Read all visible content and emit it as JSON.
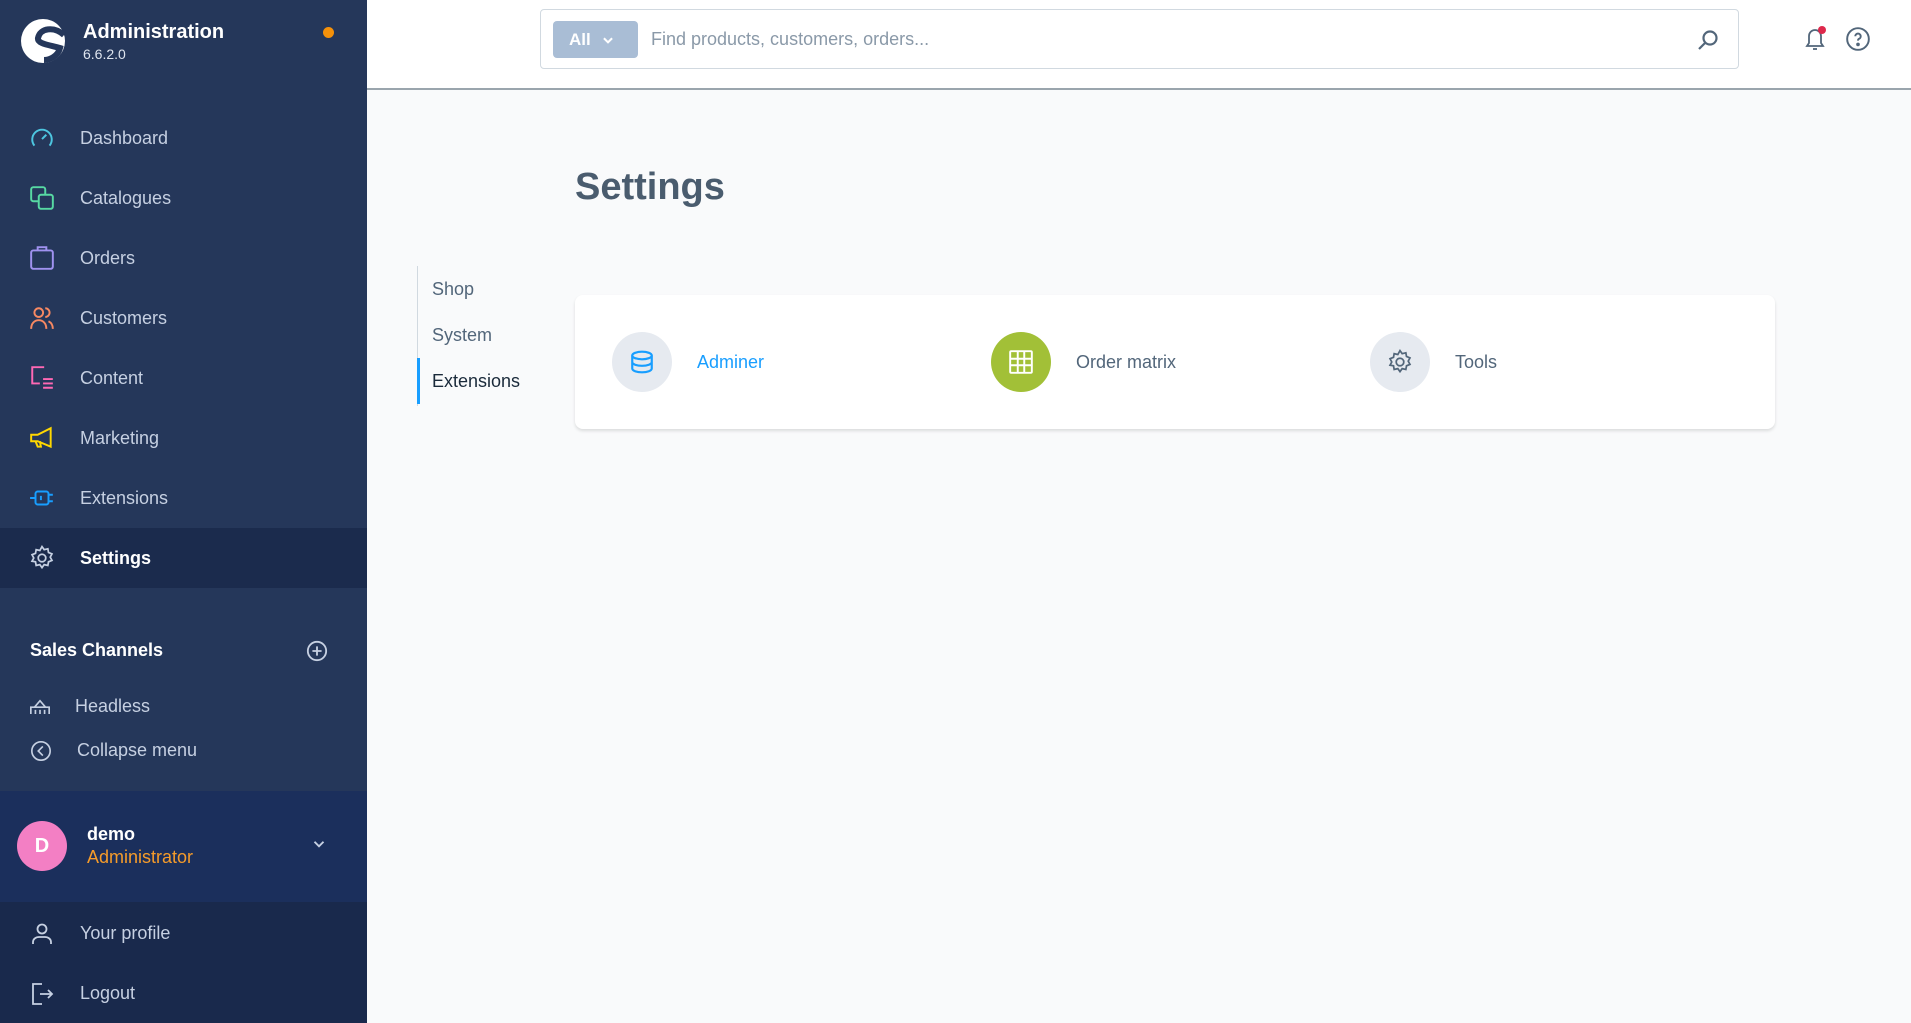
{
  "brand": {
    "title": "Administration",
    "version": "6.6.2.0"
  },
  "nav": [
    {
      "label": "Dashboard",
      "icon": "dashboard-icon",
      "color": "#4dc6e0"
    },
    {
      "label": "Catalogues",
      "icon": "catalogues-icon",
      "color": "#57d9a3"
    },
    {
      "label": "Orders",
      "icon": "orders-icon",
      "color": "#a092f0"
    },
    {
      "label": "Customers",
      "icon": "customers-icon",
      "color": "#f88962"
    },
    {
      "label": "Content",
      "icon": "content-icon",
      "color": "#ff68b4"
    },
    {
      "label": "Marketing",
      "icon": "marketing-icon",
      "color": "#ffd700"
    },
    {
      "label": "Extensions",
      "icon": "extensions-icon",
      "color": "#189eff"
    },
    {
      "label": "Settings",
      "icon": "gear-icon",
      "color": "#c6d0e2",
      "active": true
    }
  ],
  "sales_channels": {
    "title": "Sales Channels",
    "items": [
      {
        "label": "Headless"
      }
    ]
  },
  "collapse_label": "Collapse menu",
  "user": {
    "initial": "D",
    "name": "demo",
    "role": "Administrator"
  },
  "user_menu": [
    {
      "label": "Your profile"
    },
    {
      "label": "Logout"
    }
  ],
  "search": {
    "filter": "All",
    "placeholder": "Find products, customers, orders..."
  },
  "page_title": "Settings",
  "subnav": [
    {
      "label": "Shop"
    },
    {
      "label": "System"
    },
    {
      "label": "Extensions",
      "active": true
    }
  ],
  "extensions": [
    {
      "label": "Adminer",
      "icon": "database-icon",
      "color": "#189eff"
    },
    {
      "label": "Order matrix",
      "icon": "grid-icon",
      "color": "#a2c037"
    },
    {
      "label": "Tools",
      "icon": "gear-icon",
      "color": "#52667a"
    }
  ]
}
